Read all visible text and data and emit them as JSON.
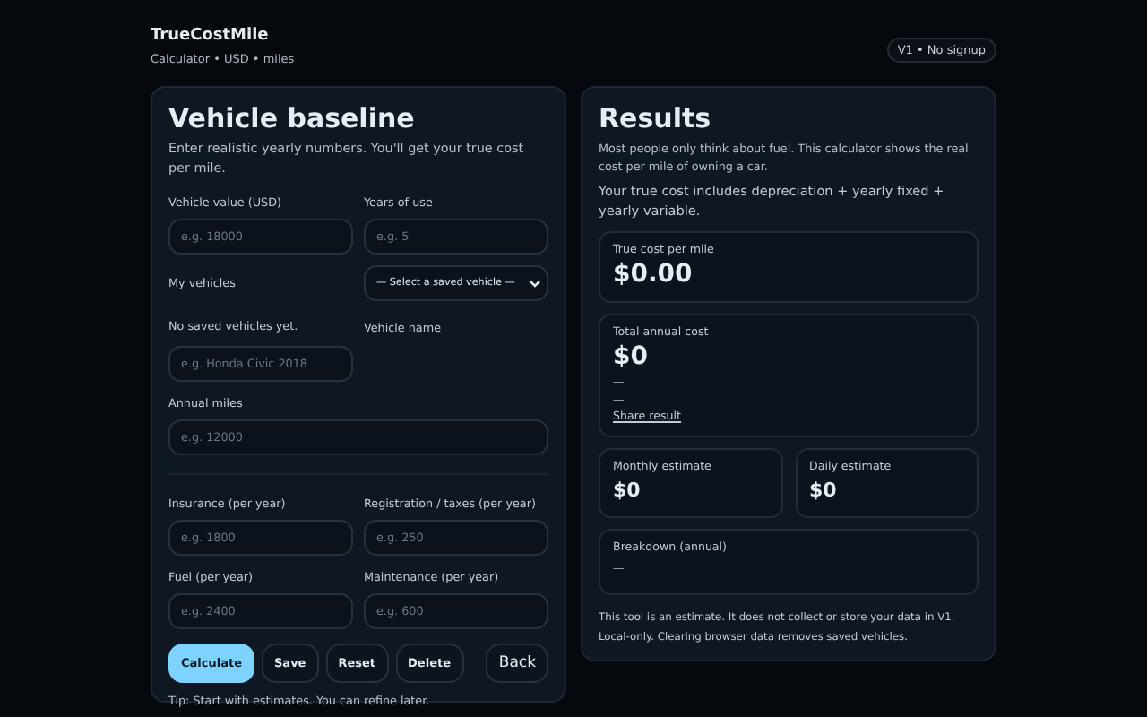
{
  "header": {
    "title": "TrueCostMile",
    "subtitle": "Calculator • USD • miles",
    "badge": "V1 • No signup"
  },
  "baseline": {
    "title": "Vehicle baseline",
    "intro": "Enter realistic yearly numbers. You'll get your true cost per mile.",
    "vehicle_value": {
      "label": "Vehicle value (USD)",
      "placeholder": "e.g. 18000"
    },
    "years": {
      "label": "Years of use",
      "placeholder": "e.g. 5"
    },
    "my_vehicles": {
      "label": "My vehicles",
      "select": "— Select a saved vehicle —",
      "empty": "No saved vehicles yet."
    },
    "vehicle_name": {
      "label": "Vehicle name",
      "placeholder": "e.g. Honda Civic 2018"
    },
    "annual_miles": {
      "label": "Annual miles",
      "placeholder": "e.g. 12000"
    },
    "costs": [
      {
        "label": "Insurance (per year)",
        "placeholder": "e.g. 1800"
      },
      {
        "label": "Registration / taxes (per year)",
        "placeholder": "e.g. 250"
      },
      {
        "label": "Fuel (per year)",
        "placeholder": "e.g. 2400"
      },
      {
        "label": "Maintenance (per year)",
        "placeholder": "e.g. 600"
      }
    ],
    "buttons": [
      {
        "label": "Calculate",
        "kind": "primary"
      },
      {
        "label": "Save",
        "kind": "secondary"
      },
      {
        "label": "Reset",
        "kind": "secondary"
      },
      {
        "label": "Delete",
        "kind": "secondary"
      },
      {
        "label": "Back",
        "kind": "back"
      }
    ],
    "tip": "Tip: Start with estimates. You can refine later."
  },
  "results": {
    "title": "Results",
    "intro": "Most people only think about fuel. This calculator shows the real cost per mile of owning a car.",
    "note": "Your true cost includes depreciation + yearly fixed + yearly variable.",
    "per_mile": {
      "label": "True cost per mile",
      "value": "$0.00"
    },
    "annual": {
      "label": "Total annual cost",
      "value": "$0",
      "lines": [
        "—",
        "—"
      ],
      "link": "Share result"
    },
    "estimates": [
      {
        "label": "Monthly estimate",
        "value": "$0"
      },
      {
        "label": "Daily estimate",
        "value": "$0"
      }
    ],
    "breakdown": {
      "label": "Breakdown (annual)",
      "value": "—"
    },
    "footer": [
      "This tool is an estimate. It does not collect or store your data in V1.",
      "Local-only. Clearing browser data removes saved vehicles."
    ]
  }
}
